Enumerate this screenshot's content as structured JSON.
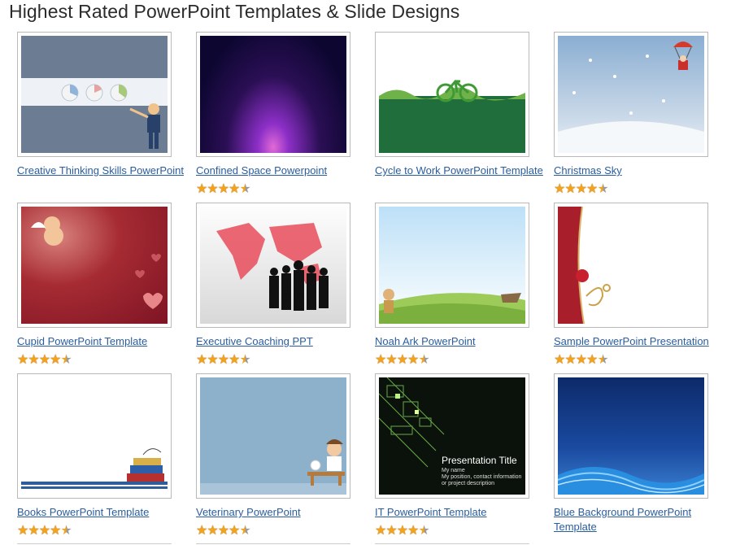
{
  "page": {
    "title": "Highest Rated PowerPoint Templates & Slide Designs"
  },
  "templates": [
    {
      "title": "Creative Thinking Skills PowerPoint",
      "rating": 0
    },
    {
      "title": "Confined Space Powerpoint",
      "rating": 4.5
    },
    {
      "title": "Cycle to Work PowerPoint Template",
      "rating": 0
    },
    {
      "title": "Christmas Sky",
      "rating": 4.5
    },
    {
      "title": "Cupid PowerPoint Template",
      "rating": 4.5
    },
    {
      "title": "Executive Coaching PPT",
      "rating": 4.5
    },
    {
      "title": "Noah Ark PowerPoint",
      "rating": 4.5
    },
    {
      "title": "Sample PowerPoint Presentation",
      "rating": 4.5
    },
    {
      "title": "Books PowerPoint Template",
      "rating": 4.5
    },
    {
      "title": "Veterinary PowerPoint",
      "rating": 4.5
    },
    {
      "title": "IT PowerPoint Template",
      "rating": 4.5
    },
    {
      "title": "Blue Background PowerPoint Template",
      "rating": 0
    }
  ],
  "thumb_text": {
    "it_title": "Presentation Title",
    "it_sub1": "My name",
    "it_sub2": "My position, contact information",
    "it_sub3": "or project description"
  },
  "colors": {
    "link": "#2a5d9f",
    "star": "#f4a21a",
    "star_off": "#9a9a9a"
  }
}
